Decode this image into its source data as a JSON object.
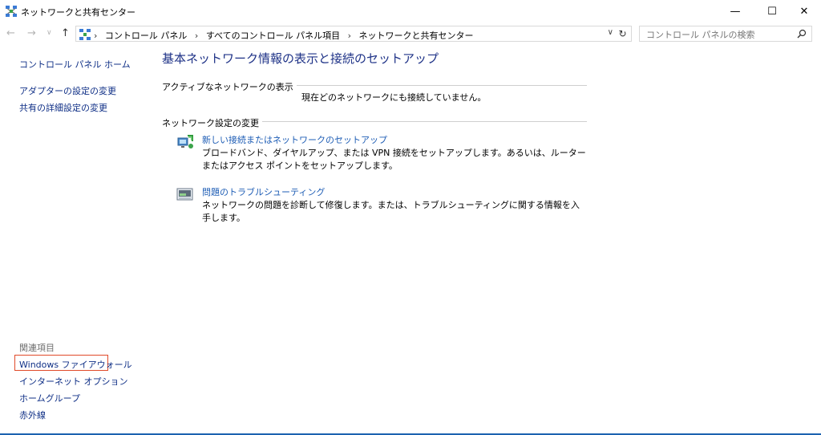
{
  "window": {
    "title": "ネットワークと共有センター",
    "minimize": "—",
    "maximize": "☐",
    "close": "✕"
  },
  "nav": {
    "back": "←",
    "forward": "→",
    "recent": "∨",
    "up": "↑"
  },
  "address": {
    "crumbs": [
      "コントロール パネル",
      "すべてのコントロール パネル項目",
      "ネットワークと共有センター"
    ],
    "separator": "›",
    "dropdown": "∨",
    "refresh": "↻"
  },
  "search": {
    "placeholder": "コントロール パネルの検索"
  },
  "sidebar": {
    "home": "コントロール パネル ホーム",
    "items": [
      "アダプターの設定の変更",
      "共有の詳細設定の変更"
    ],
    "related_header": "関連項目",
    "related": [
      "Windows ファイアウォール",
      "インターネット オプション",
      "ホームグループ",
      "赤外線"
    ]
  },
  "main": {
    "title": "基本ネットワーク情報の表示と接続のセットアップ",
    "active_section": "アクティブなネットワークの表示",
    "active_status": "現在どのネットワークにも接続していません。",
    "settings_section": "ネットワーク設定の変更",
    "tasks": [
      {
        "link": "新しい接続またはネットワークのセットアップ",
        "desc": "ブロードバンド、ダイヤルアップ、または VPN 接続をセットアップします。あるいは、ルーターまたはアクセス ポイントをセットアップします。"
      },
      {
        "link": "問題のトラブルシューティング",
        "desc": "ネットワークの問題を診断して修復します。または、トラブルシューティングに関する情報を入手します。"
      }
    ]
  },
  "colors": {
    "link": "#1e5db5",
    "title": "#1e3287",
    "highlight": "#e04a2a"
  }
}
